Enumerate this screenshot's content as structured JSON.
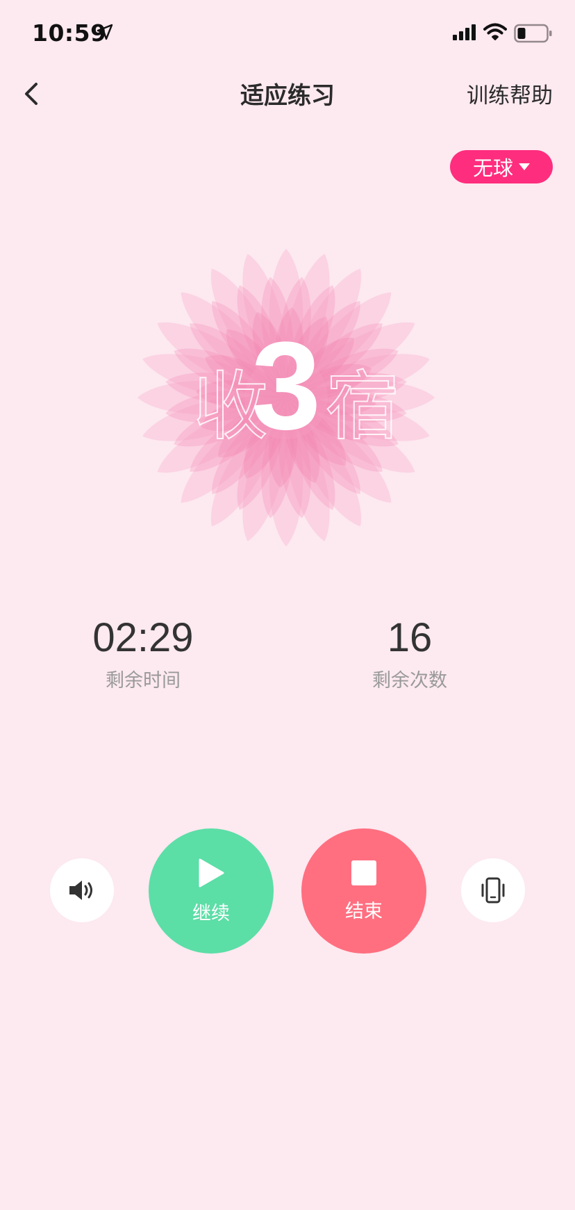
{
  "status_bar": {
    "time": "10:59",
    "icons": [
      "location-arrow-icon",
      "cellular-signal-icon",
      "wifi-icon",
      "battery-icon"
    ]
  },
  "header": {
    "title": "适应练习",
    "help_label": "训练帮助",
    "back_icon": "chevron-left-icon"
  },
  "ball_selector": {
    "label": "无球",
    "icon": "caret-down-icon"
  },
  "countdown": {
    "value": "3",
    "left_text": "收",
    "right_text": "宿"
  },
  "stats": {
    "remaining_time": {
      "value": "02:29",
      "label": "剩余时间"
    },
    "remaining_count": {
      "value": "16",
      "label": "剩余次数"
    }
  },
  "controls": {
    "sound_icon": "speaker-icon",
    "continue_label": "继续",
    "continue_icon": "play-icon",
    "end_label": "结束",
    "end_icon": "stop-icon",
    "vibrate_icon": "vibrate-phone-icon"
  },
  "colors": {
    "background": "#fde9f0",
    "accent": "#ff2d7e",
    "continue": "#5cdea7",
    "end": "#ff6f80",
    "flower": "#f9a6c7"
  }
}
